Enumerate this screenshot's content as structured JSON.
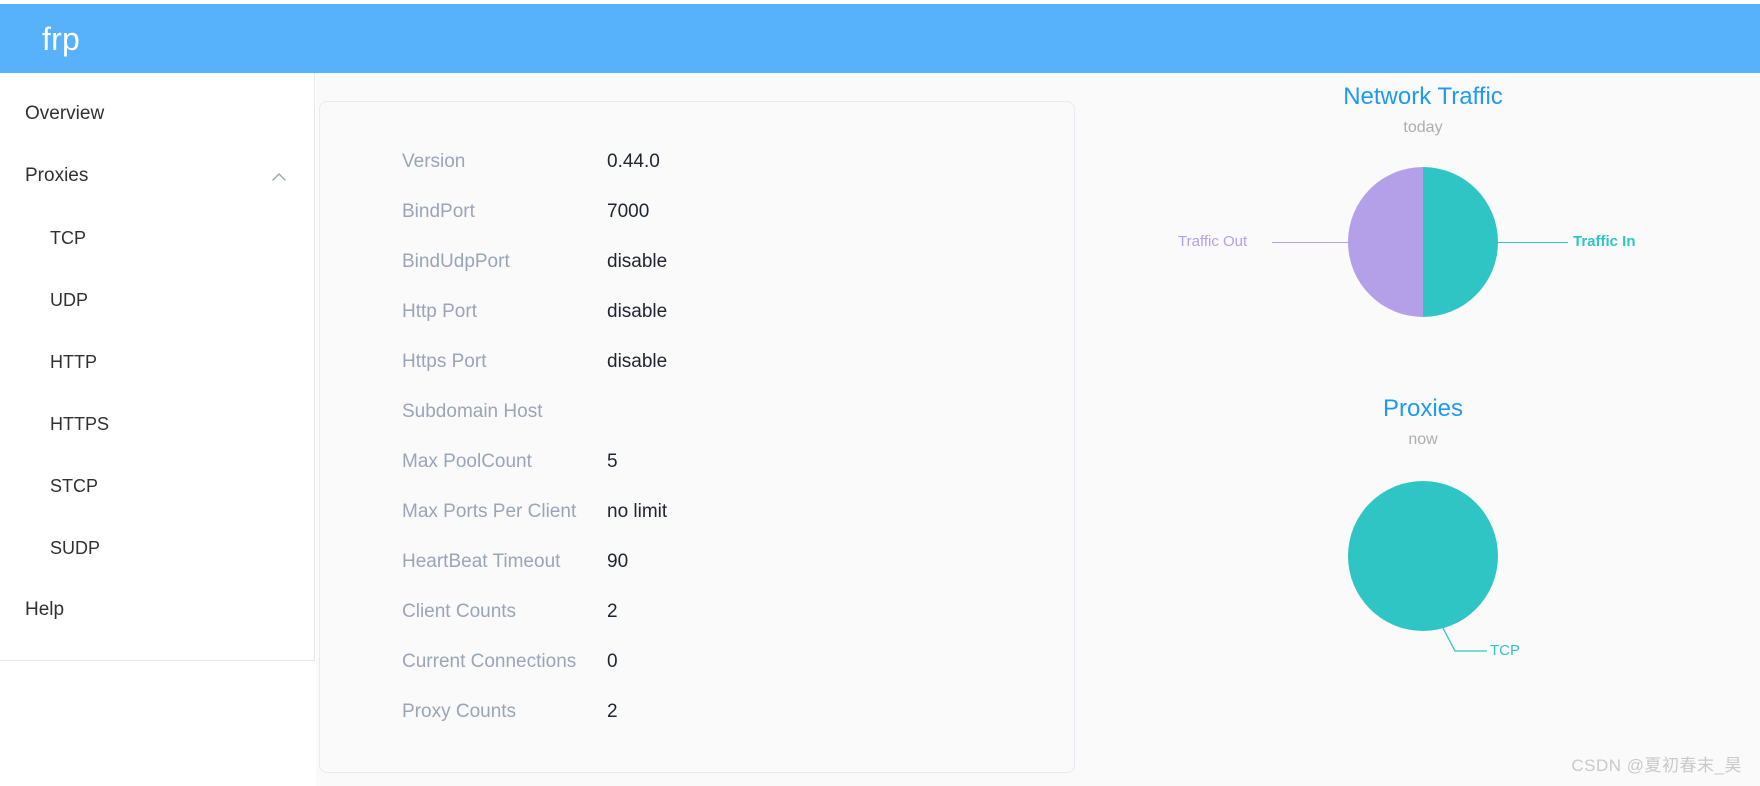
{
  "header": {
    "brand": "frp",
    "background_color": "#58b2fb"
  },
  "sidebar": {
    "items": [
      {
        "label": "Overview",
        "level": 0,
        "icon": ""
      },
      {
        "label": "Proxies",
        "level": 0,
        "icon": "chevron-up-icon"
      },
      {
        "label": "TCP",
        "level": 1,
        "icon": ""
      },
      {
        "label": "UDP",
        "level": 1,
        "icon": ""
      },
      {
        "label": "HTTP",
        "level": 1,
        "icon": ""
      },
      {
        "label": "HTTPS",
        "level": 1,
        "icon": ""
      },
      {
        "label": "STCP",
        "level": 1,
        "icon": ""
      },
      {
        "label": "SUDP",
        "level": 1,
        "icon": ""
      },
      {
        "label": "Help",
        "level": 0,
        "icon": ""
      }
    ]
  },
  "server_info": {
    "rows": [
      {
        "label": "Version",
        "value": "0.44.0"
      },
      {
        "label": "BindPort",
        "value": "7000"
      },
      {
        "label": "BindUdpPort",
        "value": "disable"
      },
      {
        "label": "Http Port",
        "value": "disable"
      },
      {
        "label": "Https Port",
        "value": "disable"
      },
      {
        "label": "Subdomain Host",
        "value": ""
      },
      {
        "label": "Max PoolCount",
        "value": "5"
      },
      {
        "label": "Max Ports Per Client",
        "value": "no limit"
      },
      {
        "label": "HeartBeat Timeout",
        "value": "90"
      },
      {
        "label": "Client Counts",
        "value": "2"
      },
      {
        "label": "Current Connections",
        "value": "0"
      },
      {
        "label": "Proxy Counts",
        "value": "2"
      }
    ]
  },
  "chart_data": [
    {
      "type": "pie",
      "title": "Network Traffic",
      "subtitle": "today",
      "categories": [
        "Traffic Out",
        "Traffic In"
      ],
      "values": [
        50,
        50
      ],
      "colors": [
        "#b3a0e8",
        "#30c5c5"
      ],
      "legend_position": "outside-labels",
      "labels": [
        "Traffic Out",
        "Traffic In"
      ]
    },
    {
      "type": "pie",
      "title": "Proxies",
      "subtitle": "now",
      "categories": [
        "TCP"
      ],
      "values": [
        100
      ],
      "colors": [
        "#30c5c5"
      ],
      "legend_position": "outside-labels",
      "labels": [
        "TCP"
      ]
    }
  ],
  "watermark": {
    "text": "CSDN @夏初春末_昊"
  }
}
